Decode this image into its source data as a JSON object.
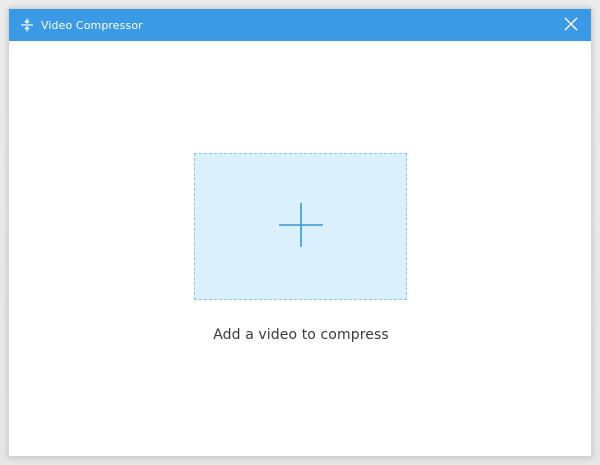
{
  "window": {
    "title": "Video Compressor",
    "title_icon": "compress-arrows-icon",
    "close_icon": "close-icon",
    "accent_color": "#3b9ae6"
  },
  "main": {
    "dropzone_icon": "plus-icon",
    "prompt": "Add a video to compress",
    "dropzone_bg": "#daf0fd",
    "dropzone_border": "#8ec6ec"
  }
}
